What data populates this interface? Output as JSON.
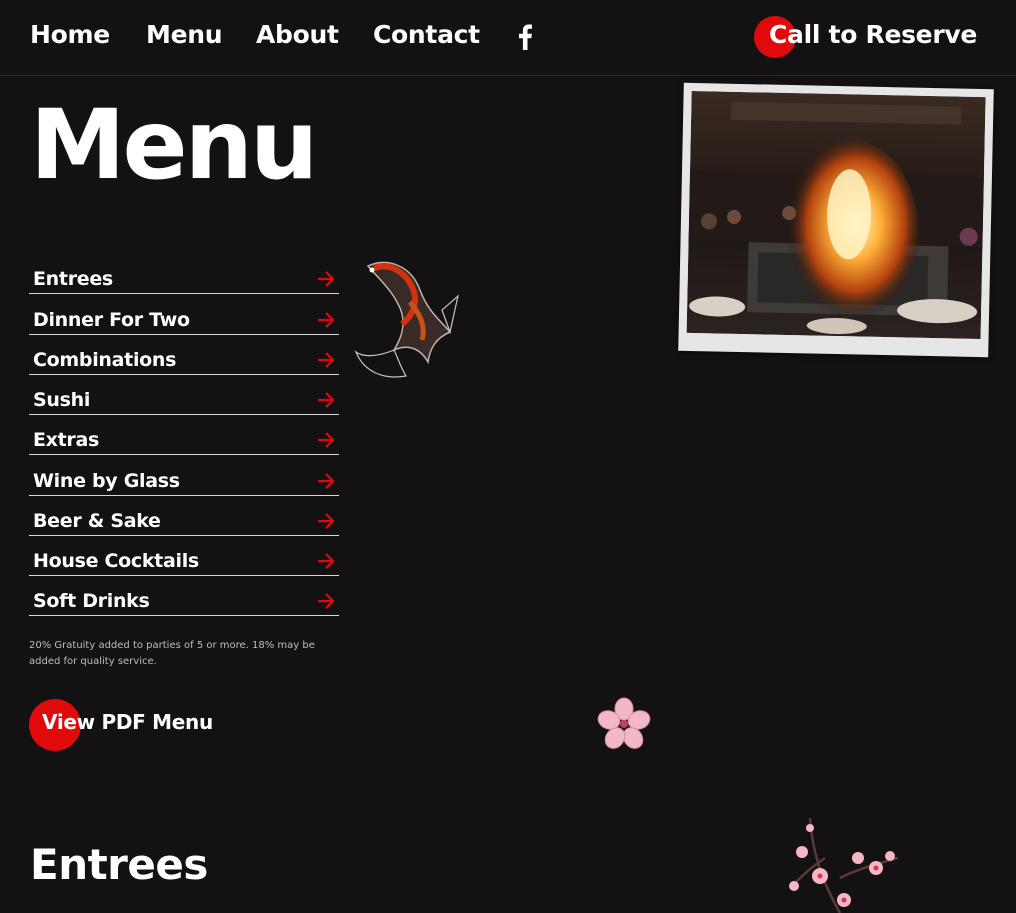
{
  "nav": {
    "home": "Home",
    "menu": "Menu",
    "about": "About",
    "contact": "Contact",
    "facebook_icon": "facebook-icon",
    "reserve": "Call to Reserve"
  },
  "page_title": "Menu",
  "menu_items": [
    {
      "label": "Entrees"
    },
    {
      "label": "Dinner For Two"
    },
    {
      "label": "Combinations"
    },
    {
      "label": "Sushi"
    },
    {
      "label": "Extras"
    },
    {
      "label": "Wine by Glass"
    },
    {
      "label": "Beer & Sake"
    },
    {
      "label": "House Cocktails"
    },
    {
      "label": "Soft Drinks"
    }
  ],
  "note": "20% Gratuity added to parties of 5 or more. 18% may be added for quality service.",
  "pdf_button": "View PDF Menu",
  "section_title": "Entrees",
  "colors": {
    "background": "#141113",
    "accent": "#e00a0a",
    "text": "#ffffff"
  }
}
